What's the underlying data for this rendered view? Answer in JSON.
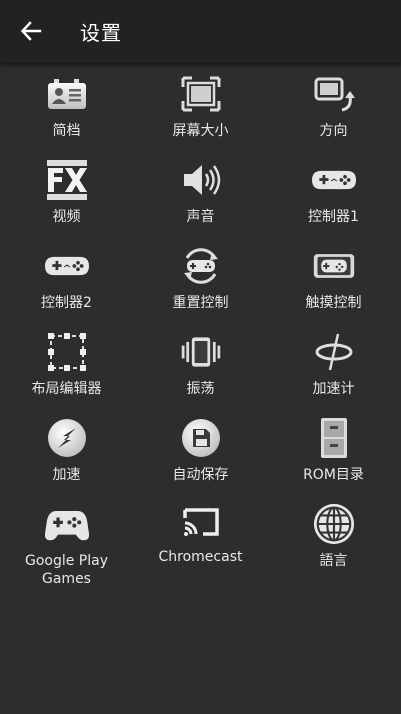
{
  "header": {
    "title": "设置"
  },
  "items": [
    {
      "label": "简档",
      "icon": "profile-card-icon"
    },
    {
      "label": "屏幕大小",
      "icon": "screen-size-icon"
    },
    {
      "label": "方向",
      "icon": "rotate-orientation-icon"
    },
    {
      "label": "视频",
      "icon": "fx-video-icon"
    },
    {
      "label": "声音",
      "icon": "speaker-volume-icon"
    },
    {
      "label": "控制器1",
      "icon": "gamepad-icon"
    },
    {
      "label": "控制器2",
      "icon": "gamepad-icon"
    },
    {
      "label": "重置控制",
      "icon": "reset-controls-icon"
    },
    {
      "label": "触摸控制",
      "icon": "touch-controls-icon"
    },
    {
      "label": "布局编辑器",
      "icon": "layout-editor-icon"
    },
    {
      "label": "振荡",
      "icon": "vibration-icon"
    },
    {
      "label": "加速计",
      "icon": "accelerometer-icon"
    },
    {
      "label": "加速",
      "icon": "speed-up-icon"
    },
    {
      "label": "自动保存",
      "icon": "autosave-floppy-icon"
    },
    {
      "label": "ROM目录",
      "icon": "file-cabinet-icon"
    },
    {
      "label": "Google Play\nGames",
      "icon": "google-play-games-controller-icon"
    },
    {
      "label": "Chromecast",
      "icon": "chromecast-icon"
    },
    {
      "label": "語言",
      "icon": "globe-language-icon"
    }
  ]
}
